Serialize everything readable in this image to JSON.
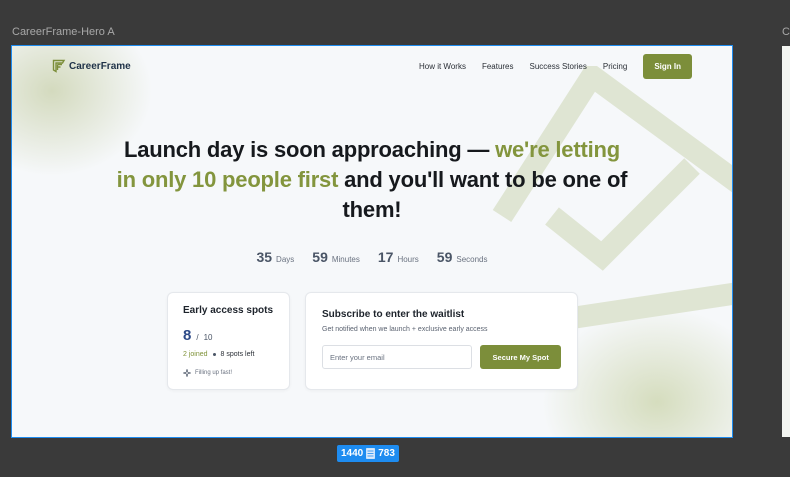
{
  "canvas": {
    "frame_label": "CareerFrame-Hero A",
    "next_frame_label": "C",
    "size_badge": {
      "width": "1440",
      "height": "783"
    }
  },
  "nav": {
    "logo_text": "CareerFrame",
    "links": [
      "How it Works",
      "Features",
      "Success Stories",
      "Pricing"
    ],
    "sign_in_label": "Sign In"
  },
  "hero": {
    "headline_part1": "Launch day is soon approaching — ",
    "headline_accent": "we're letting in only 10 people first",
    "headline_part2": " and you'll want to be one of them!"
  },
  "countdown": [
    {
      "value": "35",
      "unit": "Days"
    },
    {
      "value": "59",
      "unit": "Minutes"
    },
    {
      "value": "17",
      "unit": "Hours"
    },
    {
      "value": "59",
      "unit": "Seconds"
    }
  ],
  "early_access": {
    "title": "Early access spots",
    "count": "8",
    "total": "10",
    "joined": "2 joined",
    "spots_left": "8 spots left",
    "note": "Filling up fast!"
  },
  "subscribe": {
    "title": "Subscribe to enter the waitlist",
    "description": "Get notified when we launch + exclusive early access",
    "email_placeholder": "Enter your email",
    "button_label": "Secure My Spot"
  },
  "colors": {
    "accent": "#83953d",
    "button": "#7c8e3a",
    "selection": "#1e8cf0",
    "canvas": "#3a3a3a"
  }
}
